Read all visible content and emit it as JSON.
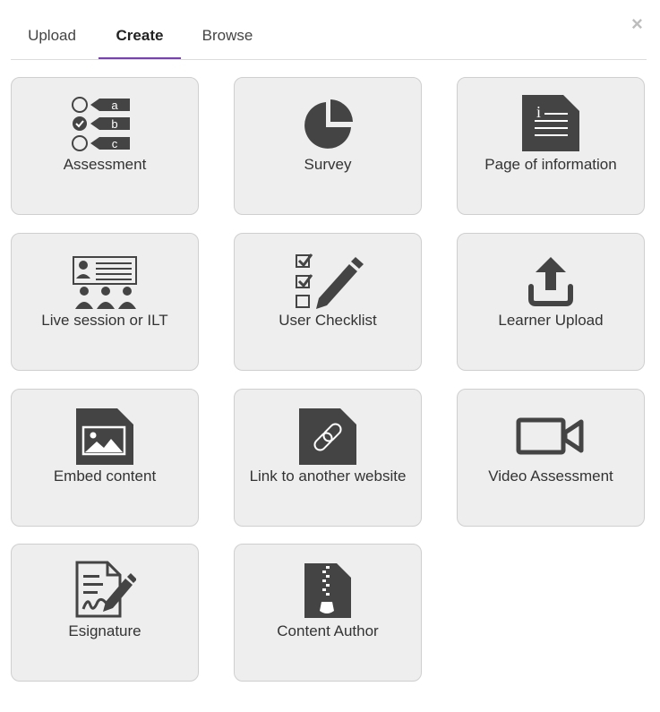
{
  "tabs": [
    {
      "label": "Upload",
      "active": false
    },
    {
      "label": "Create",
      "active": true
    },
    {
      "label": "Browse",
      "active": false
    }
  ],
  "close_glyph": "×",
  "tiles": [
    {
      "label": "Assessment",
      "icon": "assessment-icon",
      "icon_letters": [
        "a",
        "b",
        "c"
      ]
    },
    {
      "label": "Survey",
      "icon": "pie-chart-icon"
    },
    {
      "label": "Page of information",
      "icon": "document-info-icon",
      "icon_glyph": "i"
    },
    {
      "label": "Live session or ILT",
      "icon": "classroom-icon"
    },
    {
      "label": "User Checklist",
      "icon": "checklist-pencil-icon"
    },
    {
      "label": "Learner Upload",
      "icon": "upload-icon"
    },
    {
      "label": "Embed content",
      "icon": "image-icon"
    },
    {
      "label": "Link to another website",
      "icon": "link-icon"
    },
    {
      "label": "Video Assessment",
      "icon": "video-camera-icon"
    },
    {
      "label": "Esignature",
      "icon": "signature-icon"
    },
    {
      "label": "Content Author",
      "icon": "zip-file-icon"
    }
  ],
  "colors": {
    "icon": "#444444",
    "tile_bg": "#eeeeee",
    "tab_accent": "#7b3fb5"
  }
}
